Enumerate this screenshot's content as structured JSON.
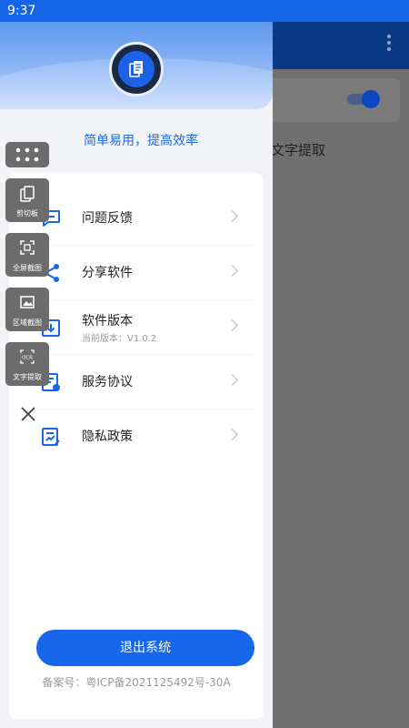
{
  "status_bar": {
    "time": "9:37"
  },
  "background_app": {
    "ocr_label": "文字提取"
  },
  "drawer": {
    "slogan": "简单易用，提高效率",
    "menu": [
      {
        "label": "问题反馈",
        "icon": "feedback-icon"
      },
      {
        "label": "分享软件",
        "icon": "share-icon"
      },
      {
        "label": "软件版本",
        "sub": "当前版本：V1.0.2",
        "icon": "version-icon"
      },
      {
        "label": "服务协议",
        "icon": "agreement-icon"
      },
      {
        "label": "隐私政策",
        "icon": "privacy-icon"
      }
    ],
    "logout_label": "退出系统",
    "icp": "备案号：粤ICP备2021125492号-30A"
  },
  "float_panel": {
    "buttons": [
      {
        "label": "剪切板",
        "icon": "clipboard-icon"
      },
      {
        "label": "全屏截图",
        "icon": "fullscreen-capture-icon"
      },
      {
        "label": "区域截图",
        "icon": "region-capture-icon"
      },
      {
        "label": "文字提取",
        "icon": "ocr-icon"
      }
    ],
    "ocr_glyph": "OCR"
  },
  "colors": {
    "accent": "#1866ea",
    "status_bar": "#1565e8"
  }
}
